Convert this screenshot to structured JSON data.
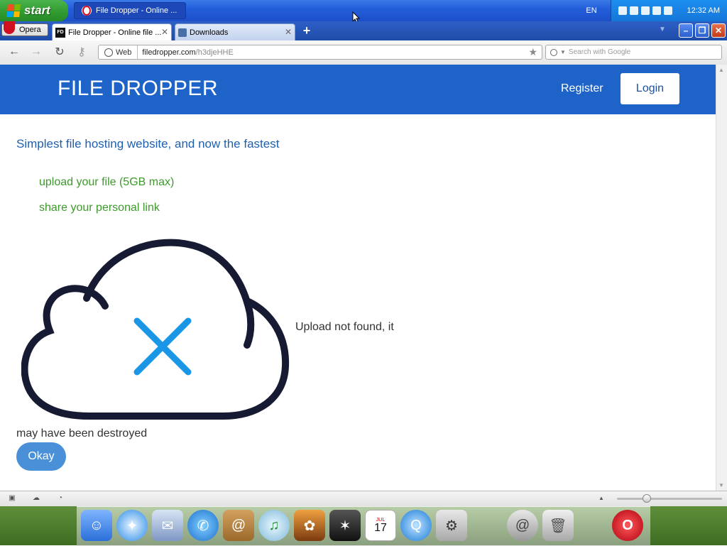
{
  "taskbar": {
    "start_label": "start",
    "task_label": "File Dropper - Online ...",
    "language": "EN",
    "clock": "12:32 AM"
  },
  "browser": {
    "menu_label": "Opera",
    "tabs": [
      {
        "label": "File Dropper - Online file ...",
        "favicon": "FD",
        "active": true
      },
      {
        "label": "Downloads",
        "active": false
      }
    ],
    "address": {
      "badge": "Web",
      "host": "filedropper.com",
      "path": "/h3djeHHE"
    },
    "search_placeholder": "Search with Google"
  },
  "site": {
    "title": "FILE DROPPER",
    "register": "Register",
    "login": "Login",
    "tagline": "Simplest file hosting website, and now the fastest",
    "steps": [
      "upload your file (5GB max)",
      "share your personal link"
    ],
    "message_part1": "Upload not found, it",
    "message_part2": "may have been destroyed",
    "okay": "Okay",
    "colors": {
      "header": "#1e64c8",
      "tagline": "#1f5fb0",
      "steps": "#3c9a2a",
      "cloud_outline": "#171a33",
      "cross": "#1a96e6",
      "button": "#4a90d9"
    }
  },
  "dock": {
    "icons": [
      "finder-icon",
      "safari-icon",
      "mail-icon",
      "ichat-icon",
      "address-book-icon",
      "itunes-icon",
      "iphoto-icon",
      "imovie-icon",
      "ical-icon",
      "quicktime-icon",
      "system-preferences-icon",
      "mail-at-icon",
      "trash-icon",
      "opera-icon"
    ],
    "calendar_month": "JUL",
    "calendar_day": "17"
  }
}
